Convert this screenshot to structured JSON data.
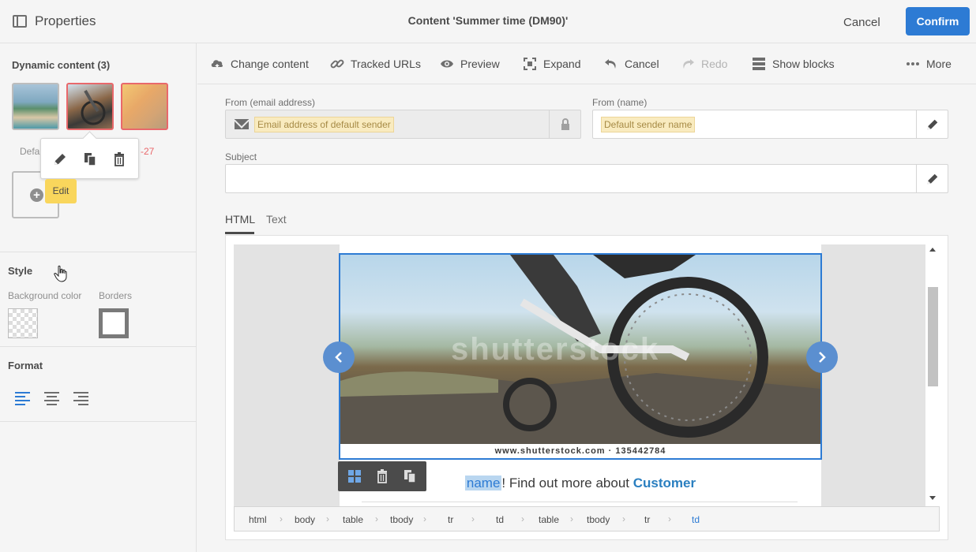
{
  "header": {
    "panel_title": "Properties",
    "page_title": "Content 'Summer time (DM90)'",
    "cancel_label": "Cancel",
    "confirm_label": "Confirm",
    "accent_color": "#2d7bd4"
  },
  "left_panel": {
    "dynamic_title": "Dynamic content (3)",
    "thumbnails": [
      "beach-thumbnail",
      "bike-thumbnail",
      "sunset-beach-thumbnail"
    ],
    "thumb_label_default": "Defa",
    "thumb_label_red": "-27",
    "popup_actions": [
      "edit",
      "duplicate",
      "delete"
    ],
    "tooltip": "Edit",
    "style_title": "Style",
    "bg_color_label": "Background color",
    "borders_label": "Borders",
    "format_title": "Format"
  },
  "toolbar": {
    "items": [
      {
        "label": "Change content",
        "icon": "cloud-upload-icon",
        "enabled": true
      },
      {
        "label": "Tracked URLs",
        "icon": "link-icon",
        "enabled": true
      },
      {
        "label": "Preview",
        "icon": "eye-icon",
        "enabled": true
      },
      {
        "label": "Expand",
        "icon": "expand-icon",
        "enabled": true
      },
      {
        "label": "Cancel",
        "icon": "undo-icon",
        "enabled": true
      },
      {
        "label": "Redo",
        "icon": "redo-icon",
        "enabled": false
      },
      {
        "label": "Show blocks",
        "icon": "blocks-icon",
        "enabled": true
      },
      {
        "label": "More",
        "icon": "more-icon",
        "enabled": true
      }
    ]
  },
  "form": {
    "from_email_label": "From (email address)",
    "from_email_placeholder": "Email address of default sender",
    "from_name_label": "From (name)",
    "from_name_placeholder": "Default sender name",
    "subject_label": "Subject",
    "subject_value": ""
  },
  "editor": {
    "tabs": [
      "HTML",
      "Text"
    ],
    "active_tab": "HTML",
    "hero_caption": "www.shutterstock.com · 135442784",
    "watermark": "shutterstock",
    "text_prefix": "",
    "text_highlight": "name",
    "text_middle": "! Find out more about ",
    "text_strong": "Customer",
    "breadcrumbs": [
      "html",
      "body",
      "table",
      "tbody",
      "tr",
      "td",
      "table",
      "tbody",
      "tr",
      "td"
    ],
    "active_crumb": "td"
  }
}
